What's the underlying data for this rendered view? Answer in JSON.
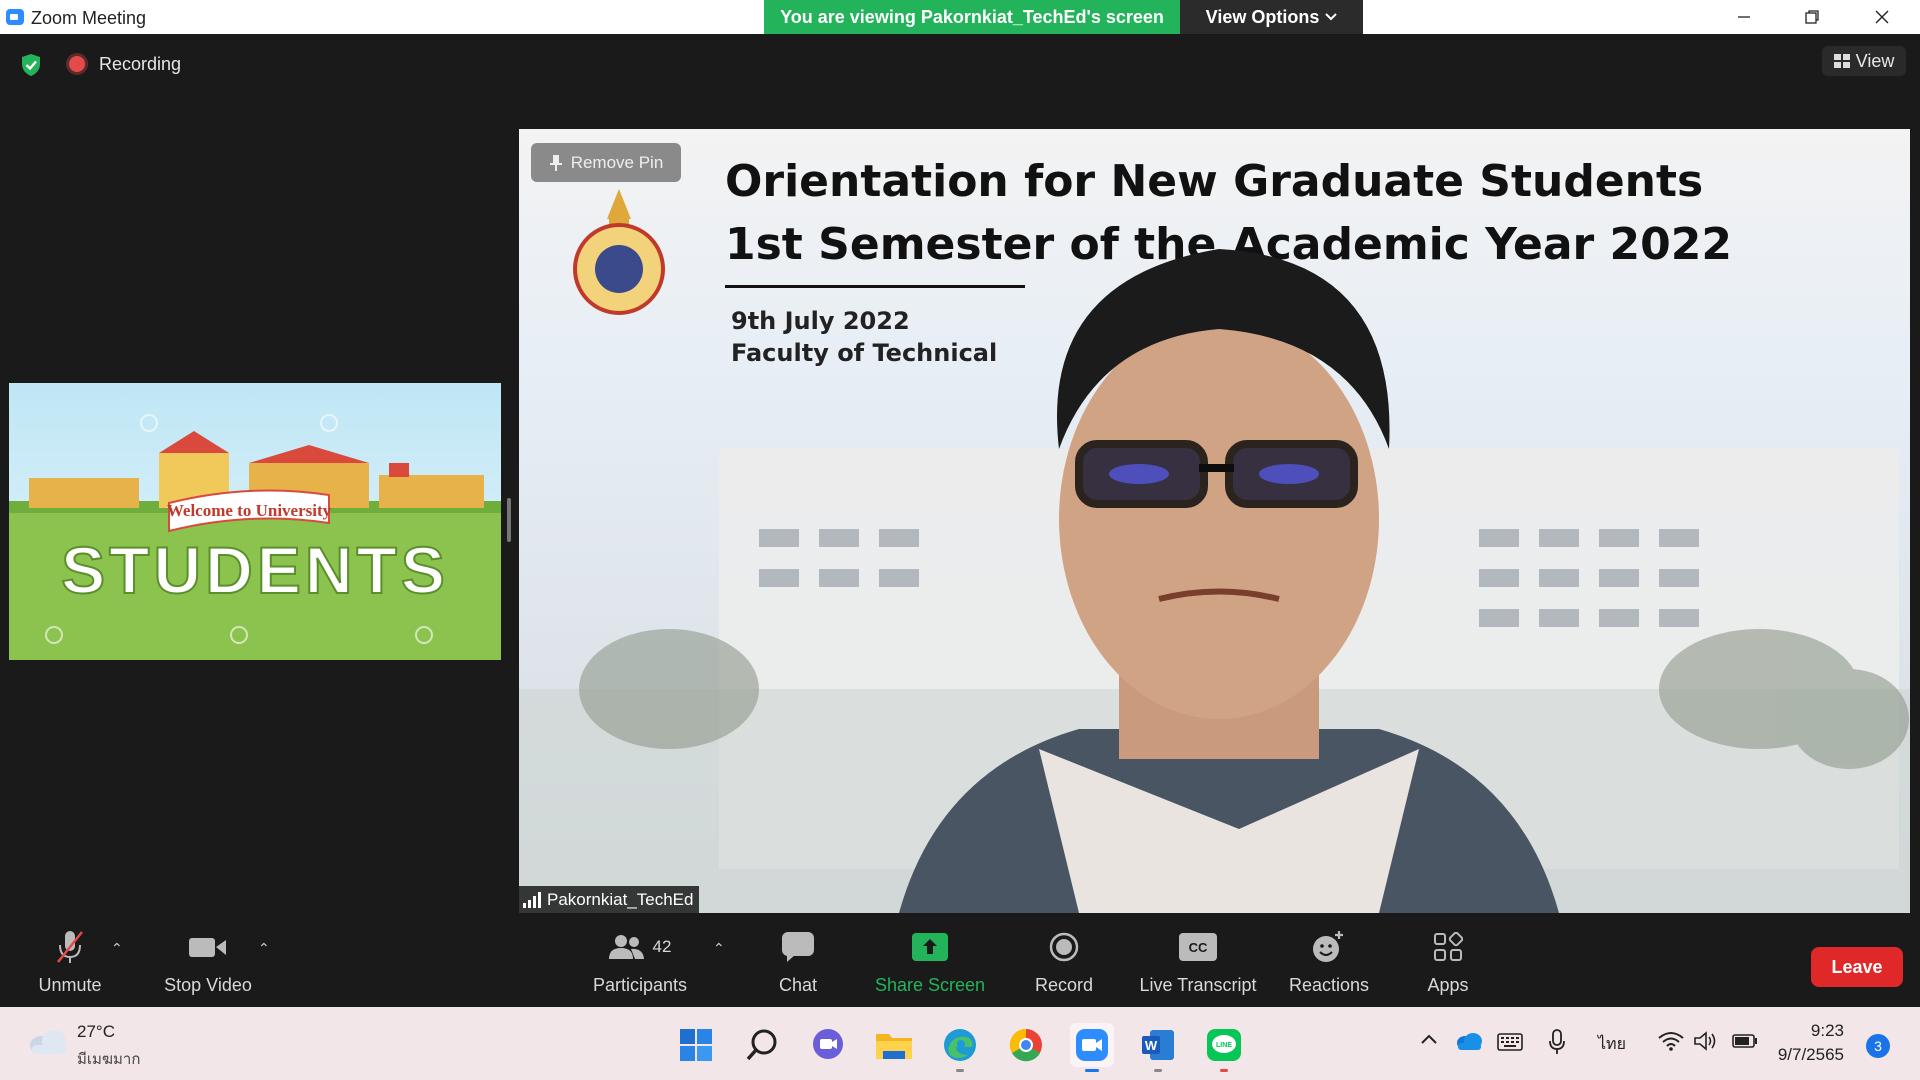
{
  "window": {
    "title": "Zoom Meeting",
    "minimize_icon": "minimize-icon",
    "restore_icon": "restore-icon",
    "close_icon": "close-icon"
  },
  "banner": {
    "viewing_text": "You are viewing Pakornkiat_TechEd's screen",
    "view_options_label": "View Options"
  },
  "status": {
    "recording_label": "Recording",
    "view_label": "View"
  },
  "thumbnail": {
    "welcome_text": "Welcome to University",
    "students_text": "STUDENTS"
  },
  "main_video": {
    "remove_pin_label": "Remove Pin",
    "slide_title_line1": "Orientation for New Graduate Students",
    "slide_title_line2": "1st Semester of the Academic Year 2022",
    "slide_date": "9th July 2022",
    "slide_faculty": "Faculty of Technical",
    "speaker_name": "Pakornkiat_TechEd"
  },
  "toolbar": {
    "unmute_label": "Unmute",
    "stop_video_label": "Stop Video",
    "participants_label": "Participants",
    "participants_count": "42",
    "chat_label": "Chat",
    "share_screen_label": "Share Screen",
    "record_label": "Record",
    "live_transcript_label": "Live Transcript",
    "reactions_label": "Reactions",
    "apps_label": "Apps",
    "leave_label": "Leave",
    "cc_text": "CC",
    "share_color": "#23b45b",
    "leave_color": "#e02828"
  },
  "taskbar": {
    "weather_temp": "27°C",
    "weather_desc": "มีเมฆมาก",
    "language": "ไทย",
    "time": "9:23",
    "date": "9/7/2565",
    "notification_count": "3"
  }
}
